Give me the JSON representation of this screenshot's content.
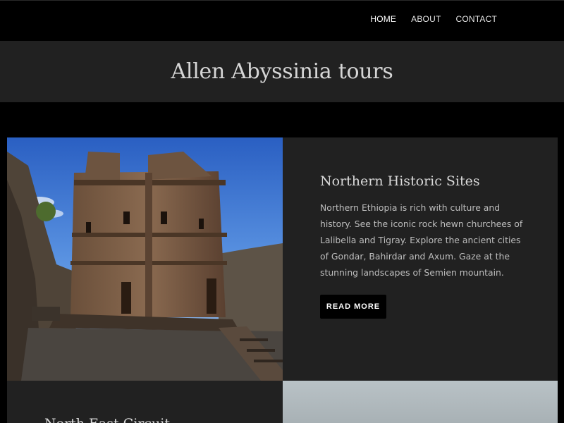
{
  "nav": {
    "items": [
      {
        "label": "HOME"
      },
      {
        "label": "ABOUT"
      },
      {
        "label": "CONTACT"
      }
    ]
  },
  "header": {
    "title": "Allen Abyssinia tours"
  },
  "sections": [
    {
      "title": "Northern Historic Sites",
      "body": "Northern Ethiopia is rich with culture and history. See the iconic rock hewn churchees of Lalibella and Tigray. Explore the ancient cities of Gondar, Bahirdar and Axum. Gaze at the stunning landscapes of Semien mountain.",
      "button_label": "READ MORE"
    },
    {
      "title": "North East Circuit"
    }
  ]
}
